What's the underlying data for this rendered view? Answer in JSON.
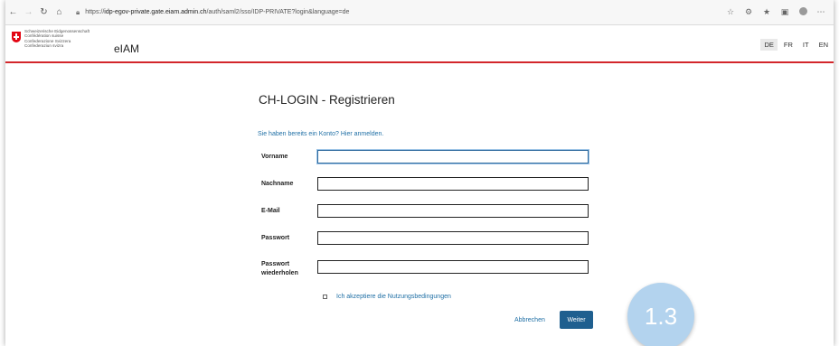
{
  "browser": {
    "url_prefix": "https://",
    "url_host": "idp-egov-private.gate.eiam.admin.ch",
    "url_path": "/auth/saml2/sso/IDP-PRIVATE?login&language=de",
    "nav_icons": [
      "back-icon",
      "forward-icon",
      "refresh-icon",
      "home-icon"
    ],
    "toolbar_icons": [
      "favorite-star-icon",
      "extension-icon",
      "favorites-icon",
      "collections-icon",
      "profile-avatar-icon",
      "more-icon"
    ]
  },
  "header": {
    "confederation_lines": [
      "Schweizerische Eidgenossenschaft",
      "Confédération suisse",
      "Confederazione Svizzera",
      "Confederaziun svizra"
    ],
    "brand": "eIAM",
    "languages": [
      "DE",
      "FR",
      "IT",
      "EN"
    ],
    "active_language": "DE"
  },
  "form": {
    "title": "CH-LOGIN - Registrieren",
    "login_hint": "Sie haben bereits ein Konto? Hier anmelden.",
    "fields": [
      {
        "label": "Vorname",
        "value": ""
      },
      {
        "label": "Nachname",
        "value": ""
      },
      {
        "label": "E-Mail",
        "value": ""
      },
      {
        "label": "Passwort",
        "value": ""
      },
      {
        "label": "Passwort wiederholen",
        "value": ""
      }
    ],
    "terms_label": "Ich akzeptiere die Nutzungsbedingungen",
    "terms_checked": false,
    "cancel_label": "Abbrechen",
    "submit_label": "Weiter"
  },
  "step_badge": "1.3",
  "colors": {
    "swiss_red": "#e30613",
    "header_rule": "#d3272b",
    "link_blue": "#1f6fa5",
    "button_blue": "#1f5f8f",
    "badge_blue": "#b3d3ee"
  }
}
